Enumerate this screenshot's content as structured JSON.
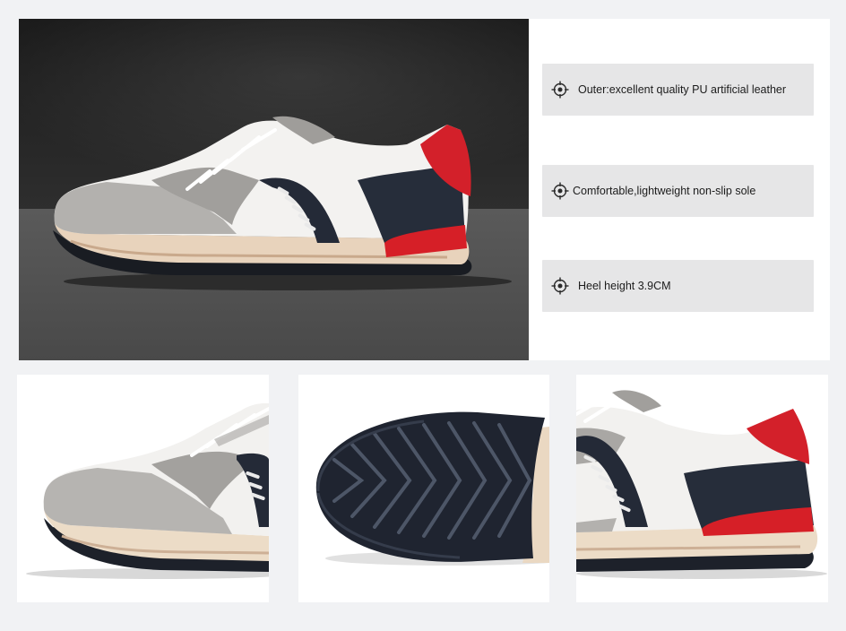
{
  "features": [
    {
      "icon": "crosshair-icon",
      "text": "Outer:excellent quality PU artificial leather"
    },
    {
      "icon": "crosshair-icon",
      "text": "Comfortable,lightweight non-slip sole"
    },
    {
      "icon": "crosshair-icon",
      "text": "Heel height 3.9CM"
    }
  ],
  "colors": {
    "page_background": "#f1f2f4",
    "feature_box": "#e6e6e7",
    "accent_red": "#d91f26",
    "navy": "#232a38",
    "suede_gray": "#a9a7a4",
    "sole_cream": "#eedfcb"
  }
}
